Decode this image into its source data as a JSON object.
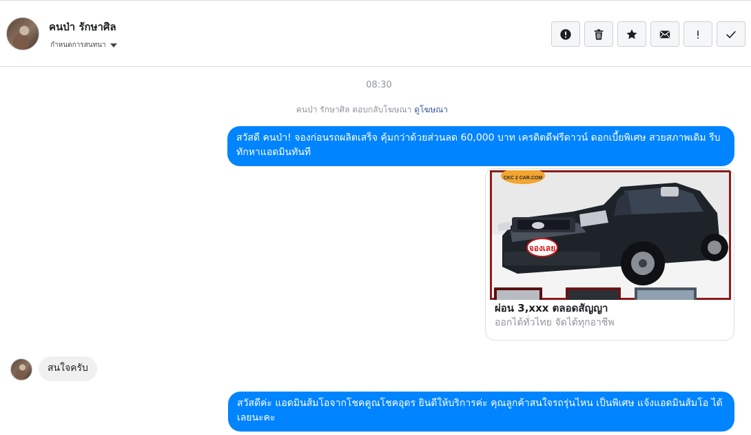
{
  "header": {
    "contact_name": "คนป่า รักษาศิล",
    "manage_label": "กำหนดการสนทนา",
    "actions": [
      {
        "name": "report-icon"
      },
      {
        "name": "trash-icon"
      },
      {
        "name": "star-icon"
      },
      {
        "name": "envelope-icon"
      },
      {
        "name": "exclamation-icon"
      },
      {
        "name": "checkmark-icon"
      }
    ]
  },
  "conversation": {
    "timestamp": "08:30",
    "ad_reply_text": "คนป่า รักษาศิล ตอบกลับโฆษณา",
    "ad_reply_link": "ดูโฆษณา",
    "messages": [
      {
        "direction": "outgoing",
        "text": "สวัสดี คนป่า! จองก่อนรถผลิตเสร็จ คุ้มกว่าด้วยส่วนลด 60,000 บาท เครดิตดีฟรีดาวน์ ดอกเบี้ยพิเศษ สวยสภาพเดิม รีบทักหาแอดมินทันที"
      },
      {
        "direction": "outgoing",
        "type": "ad-card",
        "image_logo_text": "CKC 2 CAR.COM",
        "image_stamp_text": "จองเลย",
        "title": "ผ่อน 3,xxx ตลอดสัญญา",
        "subtitle": "ออกได้ทั่วไทย จัดได้ทุกอาชีพ"
      },
      {
        "direction": "incoming",
        "text": "สนใจครับ"
      },
      {
        "direction": "outgoing",
        "text": "สวัสดีค่ะ แอดมินส้มโอจากโชคคูณโชคอุดร ยินดีให้บริการค่ะ   คุณลูกค้าสนใจรถรุ่นไหน เป็นพิเศษ แจ้งแอดมินส้มโอ ได้เลยนะคะ"
      }
    ]
  },
  "colors": {
    "outgoing_bubble": "#0084ff",
    "incoming_bubble": "#f1f0f0",
    "link": "#385898",
    "muted_text": "#90949c"
  }
}
